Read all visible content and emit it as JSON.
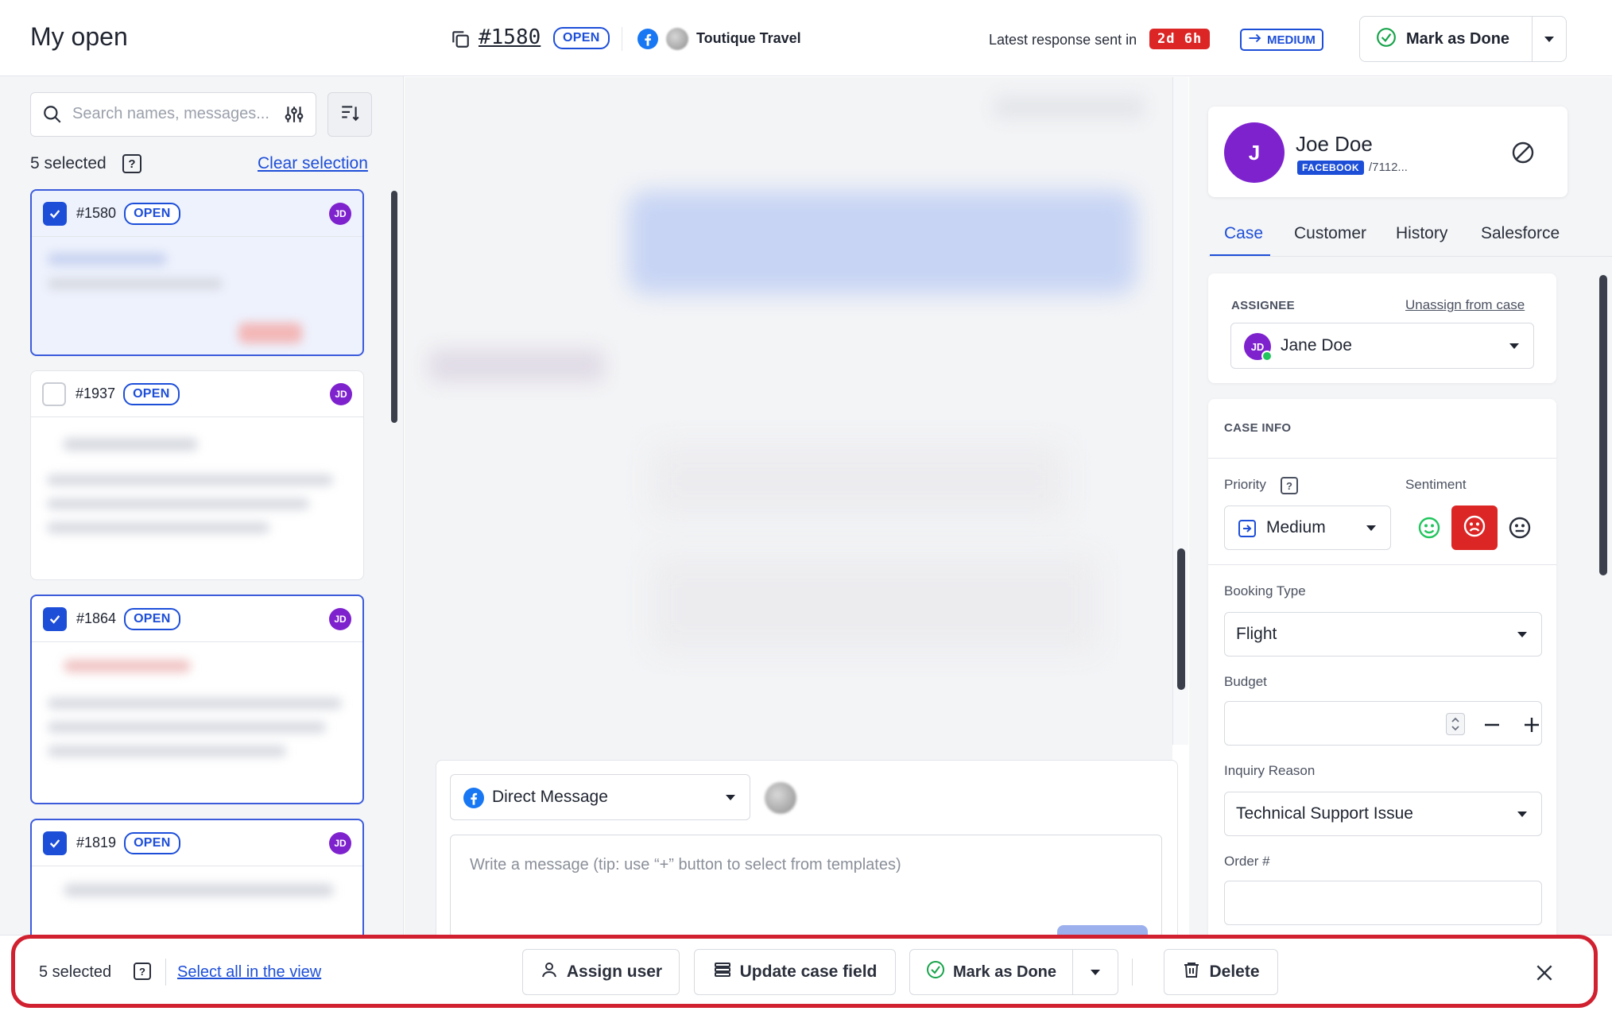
{
  "left_panel": {
    "title": "My open",
    "search_placeholder": "Search names, messages...",
    "selected_count": "5 selected",
    "clear_selection": "Clear selection",
    "cases": [
      {
        "id": "#1580",
        "status": "OPEN",
        "assignee": "JD",
        "checked": true
      },
      {
        "id": "#1937",
        "status": "OPEN",
        "assignee": "JD",
        "checked": false
      },
      {
        "id": "#1864",
        "status": "OPEN",
        "assignee": "JD",
        "checked": true
      },
      {
        "id": "#1819",
        "status": "OPEN",
        "assignee": "JD",
        "checked": true
      }
    ]
  },
  "header": {
    "case_id": "#1580",
    "status": "OPEN",
    "customer_name": "Toutique Travel",
    "latest_response_label": "Latest response sent in",
    "response_time": "2d 6h",
    "priority_badge": "MEDIUM",
    "mark_done_label": "Mark as Done"
  },
  "composer": {
    "channel": "Direct Message",
    "placeholder": "Write a message (tip: use “+” button to select from templates)"
  },
  "contact": {
    "initial": "J",
    "name": "Joe Doe",
    "network": "FACEBOOK",
    "handle": "/7112..."
  },
  "tabs": [
    "Case",
    "Customer",
    "History",
    "Salesforce"
  ],
  "assignee_section": {
    "label": "ASSIGNEE",
    "unassign": "Unassign from case",
    "assignee_initials": "JD",
    "assignee_name": "Jane Doe"
  },
  "case_info": {
    "title": "CASE INFO",
    "priority_label": "Priority",
    "priority_value": "Medium",
    "sentiment_label": "Sentiment",
    "selected_sentiment": "negative",
    "booking_type_label": "Booking Type",
    "booking_type_value": "Flight",
    "budget_label": "Budget",
    "inquiry_reason_label": "Inquiry Reason",
    "inquiry_reason_value": "Technical Support Issue",
    "order_label": "Order #"
  },
  "bulk_bar": {
    "selected_count": "5 selected",
    "select_all": "Select all in the view",
    "assign_user": "Assign user",
    "update_field": "Update case field",
    "mark_done": "Mark as Done",
    "delete": "Delete"
  },
  "colors": {
    "accent": "#1d4ed8",
    "danger": "#dc2626",
    "highlight_outline": "#d1202f",
    "avatar_purple": "#7e22ce"
  }
}
